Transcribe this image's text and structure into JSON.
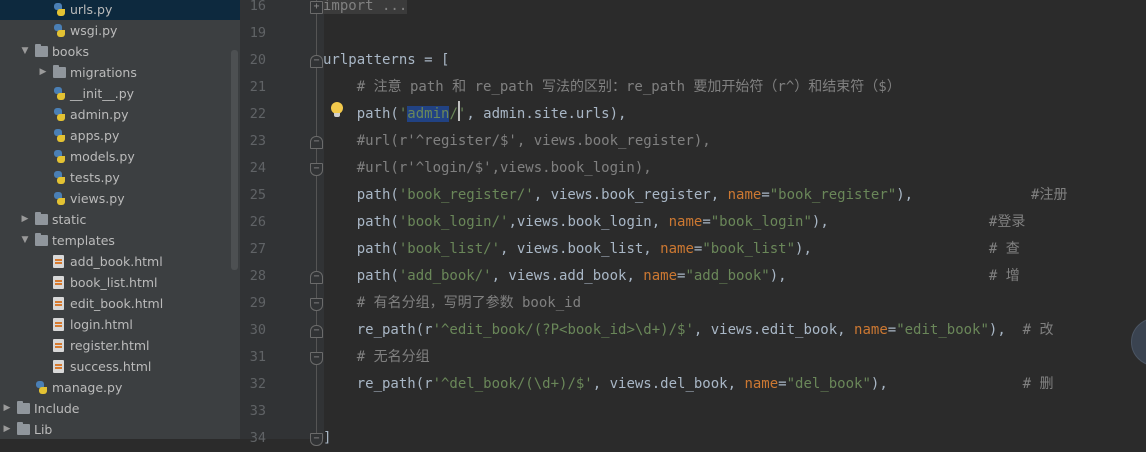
{
  "project_tree": {
    "items": [
      {
        "label": "urls.py",
        "type": "py",
        "depth": 2,
        "selected": true
      },
      {
        "label": "wsgi.py",
        "type": "py",
        "depth": 2
      },
      {
        "label": "books",
        "type": "folder",
        "depth": 1,
        "expanded": true
      },
      {
        "label": "migrations",
        "type": "folder",
        "depth": 2,
        "expanded": false
      },
      {
        "label": "__init__.py",
        "type": "py",
        "depth": 2
      },
      {
        "label": "admin.py",
        "type": "py",
        "depth": 2
      },
      {
        "label": "apps.py",
        "type": "py",
        "depth": 2
      },
      {
        "label": "models.py",
        "type": "py",
        "depth": 2
      },
      {
        "label": "tests.py",
        "type": "py",
        "depth": 2
      },
      {
        "label": "views.py",
        "type": "py",
        "depth": 2
      },
      {
        "label": "static",
        "type": "folder",
        "depth": 1,
        "expanded": false
      },
      {
        "label": "templates",
        "type": "folder",
        "depth": 1,
        "expanded": true
      },
      {
        "label": "add_book.html",
        "type": "html",
        "depth": 2
      },
      {
        "label": "book_list.html",
        "type": "html",
        "depth": 2
      },
      {
        "label": "edit_book.html",
        "type": "html",
        "depth": 2
      },
      {
        "label": "login.html",
        "type": "html",
        "depth": 2
      },
      {
        "label": "register.html",
        "type": "html",
        "depth": 2
      },
      {
        "label": "success.html",
        "type": "html",
        "depth": 2
      },
      {
        "label": "manage.py",
        "type": "py",
        "depth": 1
      },
      {
        "label": "Include",
        "type": "folder",
        "depth": 0,
        "expanded": false
      },
      {
        "label": "Lib",
        "type": "folder",
        "depth": 0,
        "expanded": false
      }
    ]
  },
  "editor": {
    "lines": [
      {
        "number": "16",
        "fold": "plus",
        "tokens": [
          [
            "fold",
            "import ..."
          ]
        ]
      },
      {
        "number": "19",
        "tokens": []
      },
      {
        "number": "20",
        "fold": "top",
        "tokens": [
          [
            "plain",
            "urlpatterns = ["
          ]
        ]
      },
      {
        "number": "21",
        "tokens": [
          [
            "comment",
            "    # 注意 path 和 re_path 写法的区别：re_path 要加开始符（r^）和结束符（$）"
          ]
        ]
      },
      {
        "number": "22",
        "bulb": true,
        "tokens": [
          [
            "plain",
            "    path("
          ],
          [
            "str",
            "'"
          ],
          [
            "sel",
            "admin"
          ],
          [
            "str",
            "/'"
          ],
          [
            "plain",
            ", admin.site.urls),"
          ]
        ]
      },
      {
        "number": "23",
        "fold": "top",
        "tokens": [
          [
            "comment",
            "    #url(r'^register/$', views.book_register),"
          ]
        ]
      },
      {
        "number": "24",
        "fold": "bottom",
        "tokens": [
          [
            "comment",
            "    #url(r'^login/$',views.book_login),"
          ]
        ]
      },
      {
        "number": "25",
        "tokens": [
          [
            "plain",
            "    path("
          ],
          [
            "str",
            "'book_register/'"
          ],
          [
            "plain",
            ", views.book_register, "
          ],
          [
            "kw",
            "name"
          ],
          [
            "plain",
            "="
          ],
          [
            "str",
            "\"book_register\""
          ],
          [
            "plain",
            "),              "
          ],
          [
            "comment",
            "#注册"
          ]
        ]
      },
      {
        "number": "26",
        "tokens": [
          [
            "plain",
            "    path("
          ],
          [
            "str",
            "'book_login/'"
          ],
          [
            "plain",
            ",views.book_login, "
          ],
          [
            "kw",
            "name"
          ],
          [
            "plain",
            "="
          ],
          [
            "str",
            "\"book_login\""
          ],
          [
            "plain",
            "),                   "
          ],
          [
            "comment",
            "#登录"
          ]
        ]
      },
      {
        "number": "27",
        "tokens": [
          [
            "plain",
            "    path("
          ],
          [
            "str",
            "'book_list/'"
          ],
          [
            "plain",
            ", views.book_list, "
          ],
          [
            "kw",
            "name"
          ],
          [
            "plain",
            "="
          ],
          [
            "str",
            "\"book_list\""
          ],
          [
            "plain",
            "),                     "
          ],
          [
            "comment",
            "# 查"
          ]
        ]
      },
      {
        "number": "28",
        "fold": "top",
        "tokens": [
          [
            "plain",
            "    path("
          ],
          [
            "str",
            "'add_book/'"
          ],
          [
            "plain",
            ", views.add_book, "
          ],
          [
            "kw",
            "name"
          ],
          [
            "plain",
            "="
          ],
          [
            "str",
            "\"add_book\""
          ],
          [
            "plain",
            "),                        "
          ],
          [
            "comment",
            "# 增"
          ]
        ]
      },
      {
        "number": "29",
        "fold": "bottom",
        "tokens": [
          [
            "comment",
            "    # 有名分组，写明了参数 book_id"
          ]
        ]
      },
      {
        "number": "30",
        "fold": "top",
        "tokens": [
          [
            "plain",
            "    re_path(r"
          ],
          [
            "str",
            "'^edit_book/(?P<book_id>\\d+)/$'"
          ],
          [
            "plain",
            ", views.edit_book, "
          ],
          [
            "kw",
            "name"
          ],
          [
            "plain",
            "="
          ],
          [
            "str",
            "\"edit_book\""
          ],
          [
            "plain",
            "),  "
          ],
          [
            "comment",
            "# 改"
          ]
        ]
      },
      {
        "number": "31",
        "fold": "bottom",
        "tokens": [
          [
            "comment",
            "    # 无名分组"
          ]
        ]
      },
      {
        "number": "32",
        "tokens": [
          [
            "plain",
            "    re_path(r"
          ],
          [
            "str",
            "'^del_book/(\\d+)/$'"
          ],
          [
            "plain",
            ", views.del_book, "
          ],
          [
            "kw",
            "name"
          ],
          [
            "plain",
            "="
          ],
          [
            "str",
            "\"del_book\""
          ],
          [
            "plain",
            "),                "
          ],
          [
            "comment",
            "# 删"
          ]
        ]
      },
      {
        "number": "33",
        "tokens": []
      },
      {
        "number": "34",
        "fold": "bottom",
        "tokens": [
          [
            "plain",
            "]"
          ]
        ]
      }
    ]
  },
  "colors": {
    "background": "#2b2b2b",
    "tree_background": "#3c3f41",
    "selection": "#0d293e",
    "string": "#6a8759",
    "keyword": "#cc7832",
    "comment": "#808080",
    "plain": "#a9b7c6"
  },
  "icons": {
    "folder": "folder-icon",
    "python_file": "python-file-icon",
    "html_file": "html-file-icon",
    "fold": "fold-marker-icon",
    "hint": "lightbulb-icon"
  }
}
